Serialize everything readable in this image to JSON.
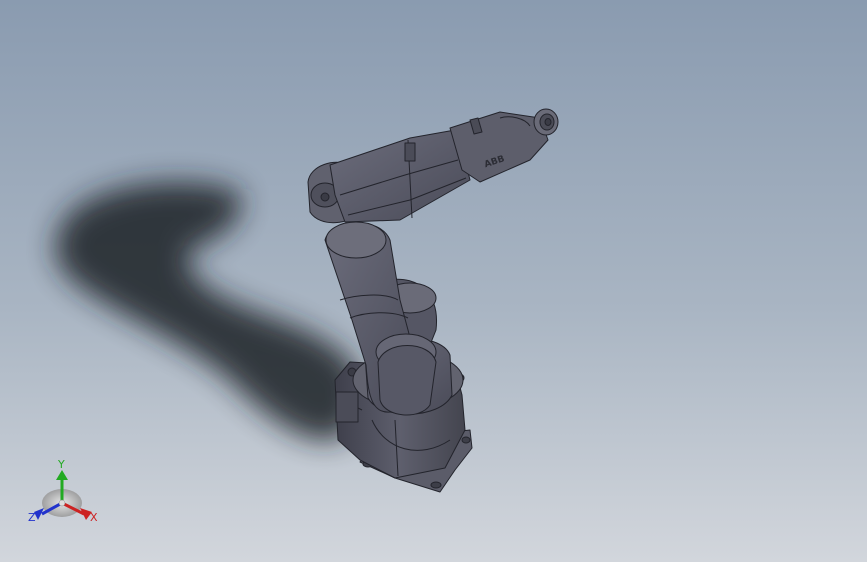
{
  "viewport": {
    "background_top": "#8a9bb0",
    "background_bottom": "#d2d6dc"
  },
  "model": {
    "logo_text": "ABB",
    "body_color": "#595a6a",
    "edge_color": "#23242c",
    "shadow_color": "#1e2026"
  },
  "triad": {
    "x_label": "X",
    "y_label": "Y",
    "z_label": "Z",
    "x_color": "#cc2222",
    "y_color": "#22aa22",
    "z_color": "#2233cc"
  }
}
